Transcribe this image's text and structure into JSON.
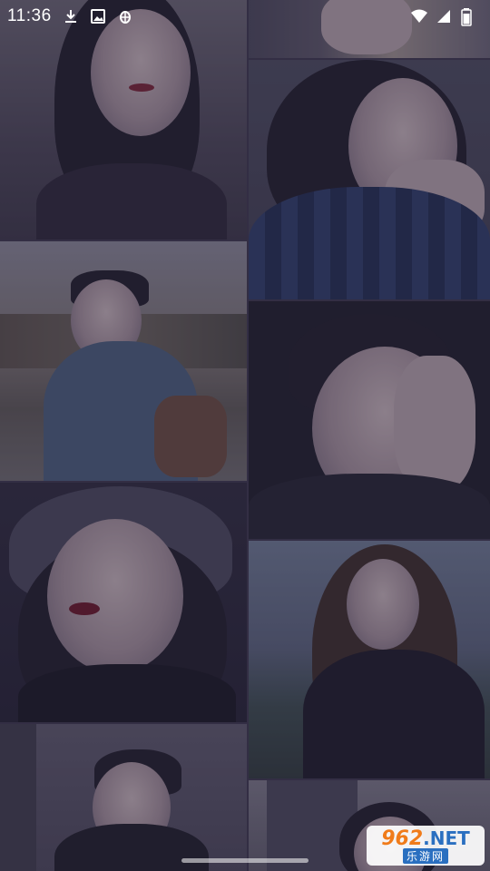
{
  "status_bar": {
    "time": "11:36",
    "left_icons": [
      "download-icon",
      "image-icon",
      "bug-icon"
    ],
    "right_icons": [
      "wifi-icon",
      "signal-icon",
      "battery-icon"
    ]
  },
  "gallery": {
    "photos": [
      {
        "id": "photo-1",
        "subject": "woman with long dark hair",
        "column": "left"
      },
      {
        "id": "photo-2",
        "subject": "woman resting chin on hand",
        "column": "right"
      },
      {
        "id": "photo-3",
        "subject": "man with backpack outdoors",
        "column": "left"
      },
      {
        "id": "photo-4",
        "subject": "man covering one eye",
        "column": "right"
      },
      {
        "id": "photo-5",
        "subject": "woman in plaid bucket hat",
        "column": "left"
      },
      {
        "id": "photo-6",
        "subject": "woman by lake",
        "column": "right"
      },
      {
        "id": "photo-7",
        "subject": "young man portrait",
        "column": "left"
      },
      {
        "id": "photo-8",
        "subject": "woman by window",
        "column": "right"
      }
    ]
  },
  "watermark": {
    "number": "962",
    "domain": ".NET",
    "chinese": "乐游网"
  },
  "colors": {
    "overlay": "#28244a",
    "watermark_orange": "#f07b1a",
    "watermark_blue": "#2a6fc0"
  }
}
